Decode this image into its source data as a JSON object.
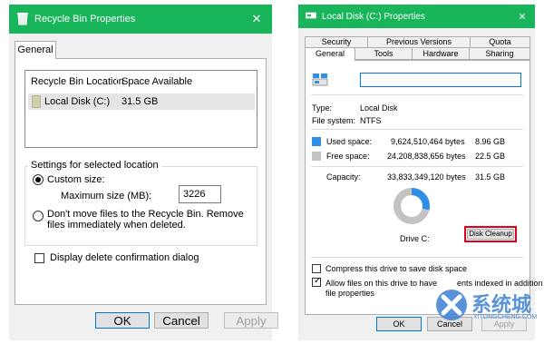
{
  "recycle": {
    "title": "Recycle Bin Properties",
    "close": "✕",
    "tab": "General",
    "columns": [
      "Recycle Bin Location",
      "Space Available"
    ],
    "row": {
      "location": "Local Disk (C:)",
      "space": "31.5 GB"
    },
    "group_title": "Settings for selected location",
    "custom_size": "Custom size:",
    "max_size_label": "Maximum size (MB):",
    "max_size_value": "3226",
    "dont_move": "Don't move files to the Recycle Bin. Remove files immediately when deleted.",
    "confirm": "Display delete confirmation dialog",
    "ok": "OK",
    "cancel": "Cancel",
    "apply": "Apply"
  },
  "disk": {
    "title": "Local Disk (C:) Properties",
    "close": "✕",
    "tabs_top": [
      "Security",
      "Previous Versions",
      "Quota"
    ],
    "tabs_bottom": [
      "General",
      "Tools",
      "Hardware",
      "Sharing"
    ],
    "type_label": "Type:",
    "type_value": "Local Disk",
    "fs_label": "File system:",
    "fs_value": "NTFS",
    "used": {
      "label": "Used space:",
      "bytes": "9,624,510,464 bytes",
      "size": "8.96 GB",
      "color": "#2d8fe5"
    },
    "free": {
      "label": "Free space:",
      "bytes": "24,208,838,656 bytes",
      "size": "22.5 GB",
      "color": "#c3c3c3"
    },
    "capacity": {
      "label": "Capacity:",
      "bytes": "33,833,349,120 bytes",
      "size": "31.5 GB"
    },
    "drive_label": "Drive C:",
    "cleanup": "Disk Cleanup",
    "cleanup_highlight": "#e0001b",
    "compress": "Compress this drive to save disk space",
    "index_line1": "Allow files on this drive to have",
    "index_line1b": "ents indexed in addition to",
    "index_line2": "file properties",
    "ok": "OK",
    "cancel": "Cancel",
    "apply": "Apply"
  },
  "watermark": {
    "text": "系统城",
    "sub": "XITONGCHENG.COM"
  }
}
